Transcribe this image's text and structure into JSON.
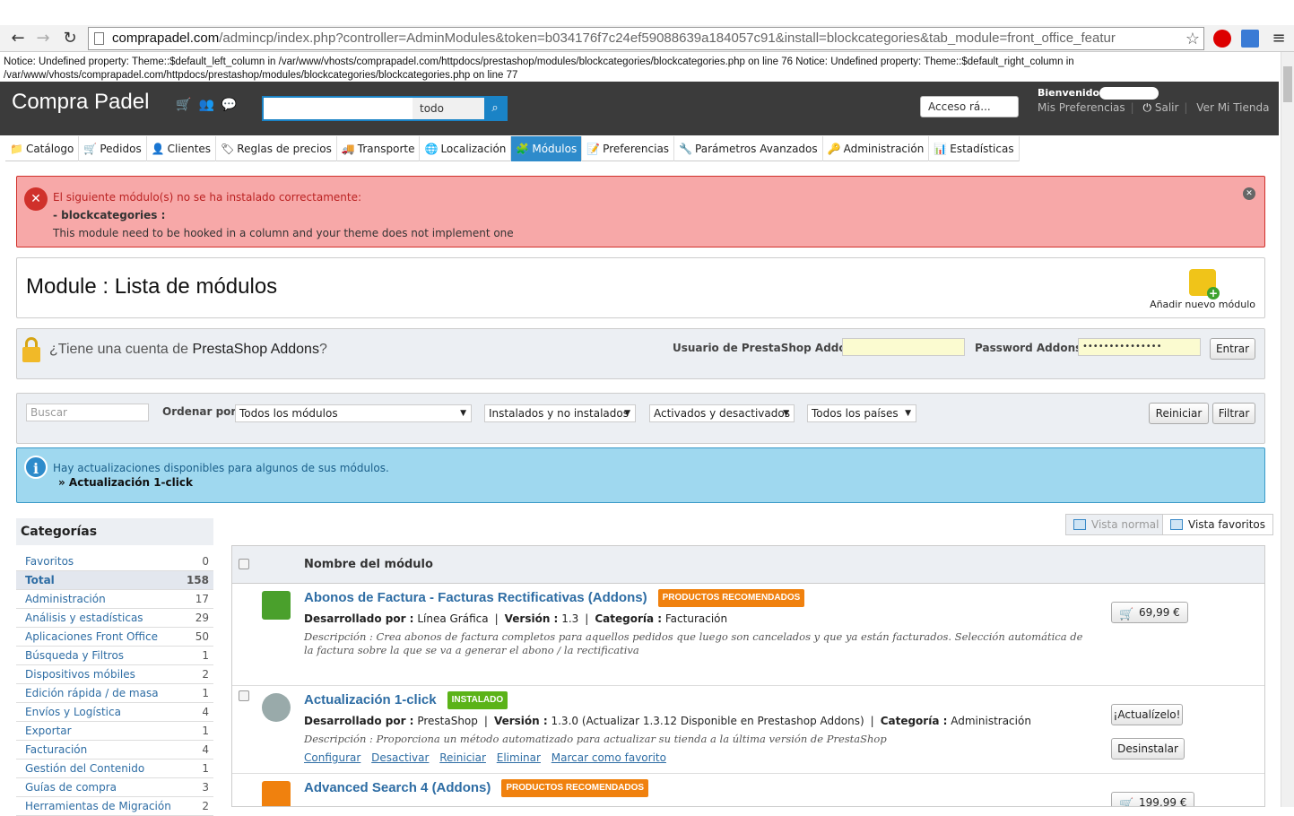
{
  "browser": {
    "url_host": "comprapadel.com",
    "url_path": "/admincp/index.php?controller=AdminModules&token=b034176f7c24ef59088639a184057c91&install=blockcategories&tab_module=front_office_featur"
  },
  "notice": "Notice: Undefined property: Theme::$default_left_column in /var/www/vhosts/comprapadel.com/httpdocs/prestashop/modules/blockcategories/blockcategories.php on line 76 Notice: Undefined property: Theme::$default_right_column in /var/www/vhosts/comprapadel.com/httpdocs/prestashop/modules/blockcategories/blockcategories.php on line 77",
  "header": {
    "brand": "Compra Padel",
    "search_scope": "todo",
    "quick_access": "Acceso rá...",
    "welcome": "Bienvenido",
    "preferences": "Mis Preferencias",
    "logout": "Salir",
    "view_shop": "Ver Mi Tienda"
  },
  "tabs": [
    {
      "label": "Catálogo",
      "icon": "folder-icon"
    },
    {
      "label": "Pedidos",
      "icon": "cart-icon"
    },
    {
      "label": "Clientes",
      "icon": "user-icon"
    },
    {
      "label": "Reglas de precios",
      "icon": "tag-icon"
    },
    {
      "label": "Transporte",
      "icon": "truck-icon"
    },
    {
      "label": "Localización",
      "icon": "globe-icon"
    },
    {
      "label": "Módulos",
      "icon": "puzzle-icon"
    },
    {
      "label": "Preferencias",
      "icon": "settings-icon"
    },
    {
      "label": "Parámetros Avanzados",
      "icon": "wrench-icon"
    },
    {
      "label": "Administración",
      "icon": "key-icon"
    },
    {
      "label": "Estadísticas",
      "icon": "stats-icon"
    }
  ],
  "error": {
    "title": "El siguiente módulo(s) no se ha instalado correctamente:",
    "module": "- blockcategories :",
    "message": "This module need to be hooked in a column and your theme does not implement one"
  },
  "page": {
    "title": "Module : Lista de módulos",
    "add_module": "Añadir nuevo módulo"
  },
  "addons": {
    "question_prefix": "¿Tiene una cuenta de ",
    "question_brand": "PrestaShop Addons",
    "question_suffix": "?",
    "user_label": "Usuario de PrestaShop Addons :",
    "password_label": "Password Addons :",
    "password_value": "•••••••••••••••",
    "login_button": "Entrar"
  },
  "filters": {
    "search_placeholder": "Buscar",
    "order_label": "Ordenar por:",
    "order_value": "Todos los módulos",
    "installed_value": "Instalados y no instalados",
    "enabled_value": "Activados y desactivados",
    "country_value": "Todos los países",
    "reset_button": "Reiniciar",
    "filter_button": "Filtrar"
  },
  "info": {
    "message": "Hay actualizaciones disponibles para algunos de sus módulos.",
    "item": "» Actualización 1-click"
  },
  "categories": {
    "title": "Categorías",
    "items": [
      {
        "label": "Favoritos",
        "count": "0"
      },
      {
        "label": "Total",
        "count": "158"
      },
      {
        "label": "Administración",
        "count": "17"
      },
      {
        "label": "Análisis y estadísticas",
        "count": "29"
      },
      {
        "label": "Aplicaciones Front Office",
        "count": "50"
      },
      {
        "label": "Búsqueda y Filtros",
        "count": "1"
      },
      {
        "label": "Dispositivos móbiles",
        "count": "2"
      },
      {
        "label": "Edición rápida / de masa",
        "count": "1"
      },
      {
        "label": "Envíos y Logística",
        "count": "4"
      },
      {
        "label": "Exportar",
        "count": "1"
      },
      {
        "label": "Facturación",
        "count": "4"
      },
      {
        "label": "Gestión del Contenido",
        "count": "1"
      },
      {
        "label": "Guías de compra",
        "count": "3"
      },
      {
        "label": "Herramientas de Migración",
        "count": "2"
      }
    ]
  },
  "views": {
    "normal": "Vista normal",
    "favorites": "Vista favoritos"
  },
  "table": {
    "header": "Nombre del módulo",
    "modules": [
      {
        "name": "Abonos de Factura - Facturas Rectificativas (Addons)",
        "badge": "PRODUCTOS RECOMENDADOS",
        "dev_label": "Desarrollado por :",
        "dev": "Línea Gráfica",
        "ver_label": "Versión :",
        "ver": "1.3",
        "cat_label": "Categoría :",
        "cat": "Facturación",
        "desc_label": "Descripción :",
        "desc": "Crea abonos de factura completos para aquellos pedidos que luego son cancelados y que ya están facturados. Selección automática de la factura sobre la que se va a generar el abono / la rectificativa",
        "price": "69,99 €"
      },
      {
        "name": "Actualización 1-click",
        "badge": "INSTALADO",
        "dev_label": "Desarrollado por :",
        "dev": "PrestaShop",
        "ver_label": "Versión :",
        "ver": "1.3.0 (Actualizar 1.3.12 Disponible en Prestashop Addons)",
        "cat_label": "Categoría :",
        "cat": "Administración",
        "desc_label": "Descripción :",
        "desc": "Proporciona un método automatizado para actualizar su tienda a la última versión de PrestaShop",
        "links": [
          "Configurar",
          "Desactivar",
          "Reiniciar",
          "Eliminar",
          "Marcar como favorito"
        ],
        "update_button": "¡Actualízelo!",
        "uninstall_button": "Desinstalar"
      },
      {
        "name": "Advanced Search 4 (Addons)",
        "badge": "PRODUCTOS RECOMENDADOS",
        "price": "199,99 €"
      }
    ]
  }
}
